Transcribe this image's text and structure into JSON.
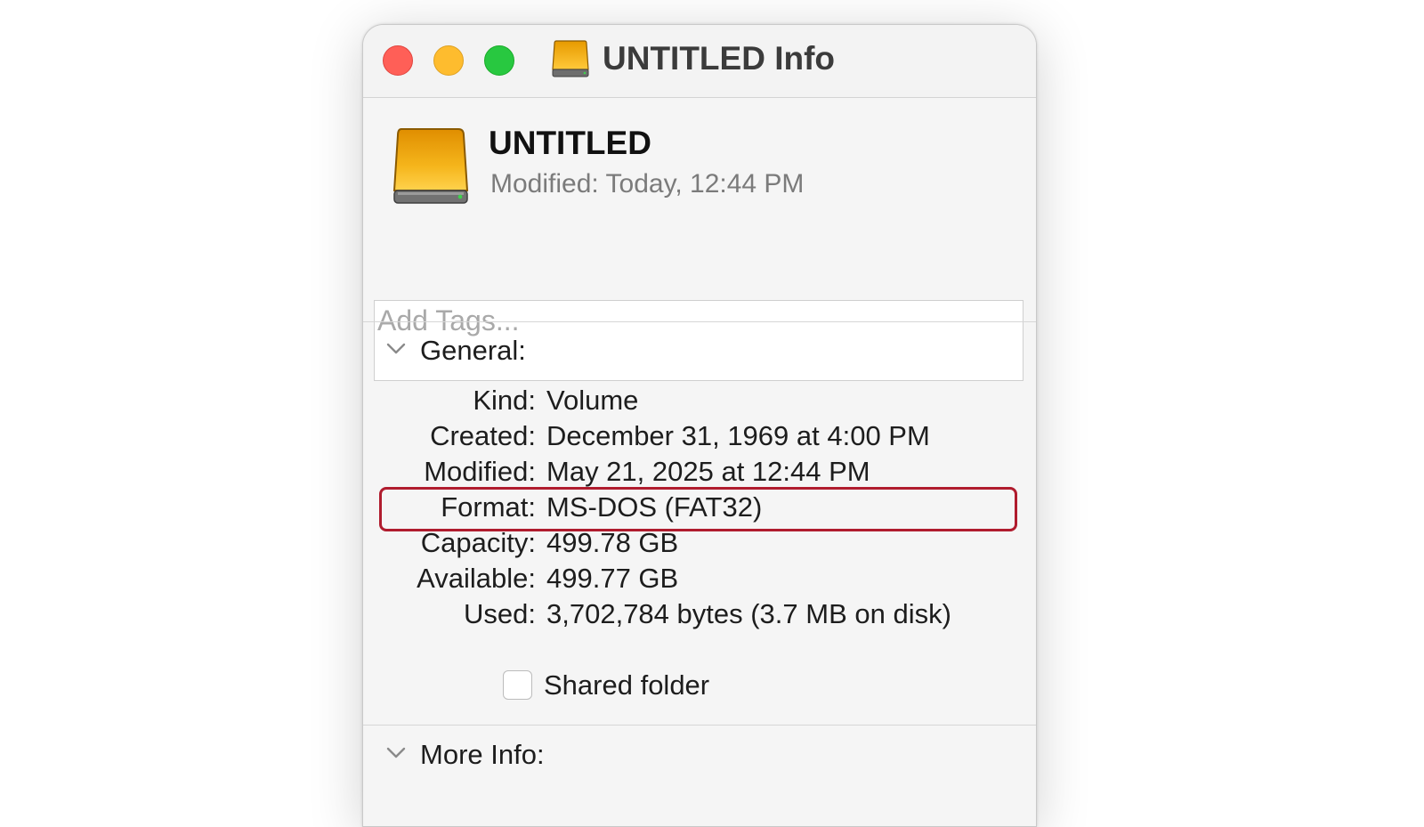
{
  "window": {
    "title": "UNTITLED Info",
    "controls": {
      "close": "close-button",
      "minimize": "minimize-button",
      "zoom": "zoom-button"
    }
  },
  "header": {
    "name": "UNTITLED",
    "modified": "Modified:  Today, 12:44 PM"
  },
  "tags": {
    "placeholder": "Add Tags..."
  },
  "general": {
    "label": "General:",
    "rows": [
      {
        "key": "Kind:",
        "value": "Volume"
      },
      {
        "key": "Created:",
        "value": "December 31, 1969 at 4:00 PM"
      },
      {
        "key": "Modified:",
        "value": "May 21, 2025 at 12:44 PM"
      },
      {
        "key": "Format:",
        "value": "MS-DOS (FAT32)"
      },
      {
        "key": "Capacity:",
        "value": "499.78 GB"
      },
      {
        "key": "Available:",
        "value": "499.77 GB"
      },
      {
        "key": "Used:",
        "value": "3,702,784 bytes (3.7 MB on disk)"
      }
    ],
    "shared_folder_label": "Shared folder",
    "shared_folder_checked": false
  },
  "more_info": {
    "label": "More Info:"
  },
  "colors": {
    "drive_icon": "#f2b418",
    "highlight": "#b01c2e",
    "traffic_close": "#ff5f57",
    "traffic_minimize": "#febc2e",
    "traffic_zoom": "#28c840"
  },
  "icons": {
    "title": "external-drive-icon",
    "header": "external-drive-icon",
    "disclosure": "chevron-down-icon"
  }
}
